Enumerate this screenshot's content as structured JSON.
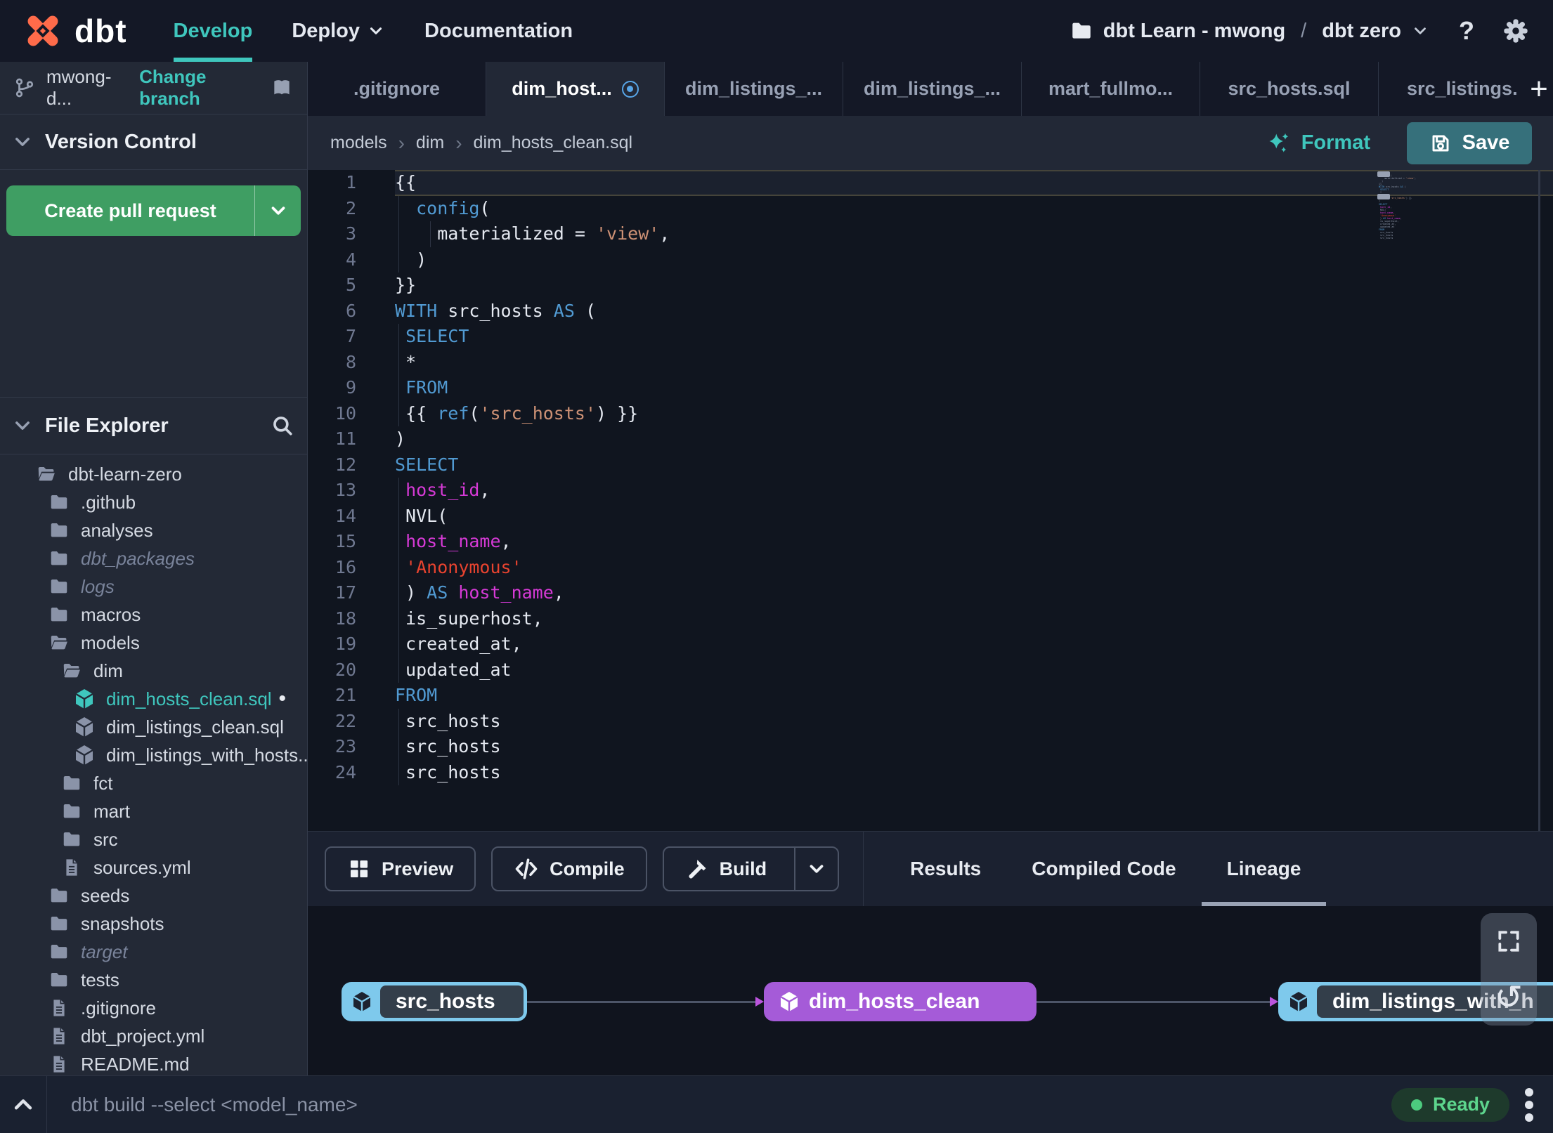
{
  "colors": {
    "accent": "#3fc6bd",
    "green_button": "#3f9e63",
    "save_button": "#36707b",
    "ready_green": "#4ccb7e",
    "node_blue": "#7ec9ec",
    "node_purple": "#a55bd8",
    "edge_gray": "#4d5568",
    "arrow_purple": "#bb54dd",
    "modified_blue": "#58a6e8",
    "logo_orange": "#ff6b4a",
    "syn_keyword": "#519ad2",
    "syn_string": "#cd9175",
    "syn_string_red": "#e8432f",
    "syn_ident": "#d63ad6",
    "text_default": "#e4e8f0",
    "line_number": "#6f7890"
  },
  "navbar": {
    "brand": "dbt",
    "items": [
      {
        "label": "Develop",
        "active": true
      },
      {
        "label": "Deploy",
        "chevron": true
      },
      {
        "label": "Documentation"
      }
    ],
    "project": {
      "name": "dbt Learn - mwong",
      "separator": "/",
      "env": "dbt zero"
    },
    "help_label": "?"
  },
  "sidebar": {
    "branch": {
      "name": "mwong-d...",
      "change_label": "Change branch"
    },
    "version_control": {
      "title": "Version Control",
      "create_pr_label": "Create pull request"
    },
    "file_explorer": {
      "title": "File Explorer",
      "tree": [
        {
          "name": "dbt-learn-zero",
          "icon": "folder-open",
          "level": 0
        },
        {
          "name": ".github",
          "icon": "folder",
          "level": 1
        },
        {
          "name": "analyses",
          "icon": "folder",
          "level": 1
        },
        {
          "name": "dbt_packages",
          "icon": "folder",
          "level": 1,
          "dim": true
        },
        {
          "name": "logs",
          "icon": "folder",
          "level": 1,
          "dim": true
        },
        {
          "name": "macros",
          "icon": "folder",
          "level": 1
        },
        {
          "name": "models",
          "icon": "folder-open",
          "level": 1
        },
        {
          "name": "dim",
          "icon": "folder-open",
          "level": 2
        },
        {
          "name": "dim_hosts_clean.sql",
          "icon": "model",
          "level": 3,
          "selected": true,
          "modified": true
        },
        {
          "name": "dim_listings_clean.sql",
          "icon": "model",
          "level": 3
        },
        {
          "name": "dim_listings_with_hosts...",
          "icon": "model",
          "level": 3
        },
        {
          "name": "fct",
          "icon": "folder",
          "level": 2
        },
        {
          "name": "mart",
          "icon": "folder",
          "level": 2
        },
        {
          "name": "src",
          "icon": "folder",
          "level": 2
        },
        {
          "name": "sources.yml",
          "icon": "file",
          "level": 2
        },
        {
          "name": "seeds",
          "icon": "folder",
          "level": 1
        },
        {
          "name": "snapshots",
          "icon": "folder",
          "level": 1
        },
        {
          "name": "target",
          "icon": "folder",
          "level": 1,
          "dim": true
        },
        {
          "name": "tests",
          "icon": "folder",
          "level": 1
        },
        {
          "name": ".gitignore",
          "icon": "file",
          "level": 1
        },
        {
          "name": "dbt_project.yml",
          "icon": "file",
          "level": 1
        },
        {
          "name": "README.md",
          "icon": "file",
          "level": 1
        }
      ]
    }
  },
  "tabs": [
    {
      "label": ".gitignore"
    },
    {
      "label": "dim_host...",
      "active": true,
      "modified": true
    },
    {
      "label": "dim_listings_..."
    },
    {
      "label": "dim_listings_..."
    },
    {
      "label": "mart_fullmo..."
    },
    {
      "label": "src_hosts.sql"
    },
    {
      "label": "src_listings.",
      "cut": true
    }
  ],
  "editor": {
    "breadcrumb": [
      "models",
      "dim",
      "dim_hosts_clean.sql"
    ],
    "format_label": "Format",
    "save_label": "Save",
    "lines": [
      {
        "n": 1,
        "a": true,
        "t": [
          [
            "p",
            "{{"
          ]
        ]
      },
      {
        "n": 2,
        "g": [
          0
        ],
        "t": [
          [
            "p",
            "  "
          ],
          [
            "k",
            "config"
          ],
          [
            "p",
            "("
          ]
        ]
      },
      {
        "n": 3,
        "g": [
          0,
          3
        ],
        "t": [
          [
            "p",
            "    materialized = "
          ],
          [
            "s",
            "'view'"
          ],
          [
            "p",
            ","
          ]
        ]
      },
      {
        "n": 4,
        "g": [
          0
        ],
        "t": [
          [
            "p",
            "  )"
          ]
        ]
      },
      {
        "n": 5,
        "t": [
          [
            "p",
            "}}"
          ]
        ]
      },
      {
        "n": 6,
        "t": [
          [
            "k",
            "WITH"
          ],
          [
            "p",
            " src_hosts "
          ],
          [
            "k",
            "AS"
          ],
          [
            "p",
            " ("
          ]
        ]
      },
      {
        "n": 7,
        "g": [
          0
        ],
        "t": [
          [
            "p",
            " "
          ],
          [
            "k",
            "SELECT"
          ]
        ]
      },
      {
        "n": 8,
        "g": [
          0
        ],
        "t": [
          [
            "p",
            " *"
          ]
        ]
      },
      {
        "n": 9,
        "g": [
          0
        ],
        "t": [
          [
            "p",
            " "
          ],
          [
            "k",
            "FROM"
          ]
        ]
      },
      {
        "n": 10,
        "g": [
          0
        ],
        "t": [
          [
            "p",
            " {{ "
          ],
          [
            "k",
            "ref"
          ],
          [
            "p",
            "("
          ],
          [
            "s",
            "'src_hosts'"
          ],
          [
            "p",
            ") }}"
          ]
        ]
      },
      {
        "n": 11,
        "t": [
          [
            "p",
            ")"
          ]
        ]
      },
      {
        "n": 12,
        "t": [
          [
            "k",
            "SELECT"
          ]
        ]
      },
      {
        "n": 13,
        "g": [
          0
        ],
        "t": [
          [
            "p",
            " "
          ],
          [
            "m",
            "host_id"
          ],
          [
            "p",
            ","
          ]
        ]
      },
      {
        "n": 14,
        "g": [
          0
        ],
        "t": [
          [
            "p",
            " NVL("
          ]
        ]
      },
      {
        "n": 15,
        "g": [
          0
        ],
        "t": [
          [
            "p",
            " "
          ],
          [
            "m",
            "host_name"
          ],
          [
            "p",
            ","
          ]
        ]
      },
      {
        "n": 16,
        "g": [
          0
        ],
        "t": [
          [
            "p",
            " "
          ],
          [
            "r",
            "'Anonymous'"
          ]
        ]
      },
      {
        "n": 17,
        "g": [
          0
        ],
        "t": [
          [
            "p",
            " ) "
          ],
          [
            "k",
            "AS"
          ],
          [
            "p",
            " "
          ],
          [
            "m",
            "host_name"
          ],
          [
            "p",
            ","
          ]
        ]
      },
      {
        "n": 18,
        "g": [
          0
        ],
        "t": [
          [
            "p",
            " is_superhost,"
          ]
        ]
      },
      {
        "n": 19,
        "g": [
          0
        ],
        "t": [
          [
            "p",
            " created_at,"
          ]
        ]
      },
      {
        "n": 20,
        "g": [
          0
        ],
        "t": [
          [
            "p",
            " updated_at"
          ]
        ]
      },
      {
        "n": 21,
        "t": [
          [
            "k",
            "FROM"
          ]
        ]
      },
      {
        "n": 22,
        "g": [
          0
        ],
        "t": [
          [
            "p",
            " src_hosts"
          ]
        ]
      },
      {
        "n": 23,
        "g": [
          0
        ],
        "t": [
          [
            "p",
            " src_hosts"
          ]
        ]
      },
      {
        "n": 24,
        "g": [
          0
        ],
        "t": [
          [
            "p",
            " src_hosts"
          ]
        ]
      }
    ]
  },
  "bottom_panel": {
    "buttons": [
      {
        "label": "Preview",
        "icon": "grid"
      },
      {
        "label": "Compile",
        "icon": "code"
      },
      {
        "label": "Build",
        "icon": "hammer",
        "split": true
      }
    ],
    "tabs": [
      {
        "label": "Results"
      },
      {
        "label": "Compiled Code"
      },
      {
        "label": "Lineage",
        "active": true
      }
    ],
    "lineage": {
      "nodes": [
        {
          "label": "src_hosts",
          "variant": "light"
        },
        {
          "label": "dim_hosts_clean",
          "variant": "purple"
        },
        {
          "label": "dim_listings_with_h",
          "variant": "light"
        }
      ]
    }
  },
  "status_bar": {
    "command": "dbt build --select <model_name>",
    "status_label": "Ready"
  }
}
